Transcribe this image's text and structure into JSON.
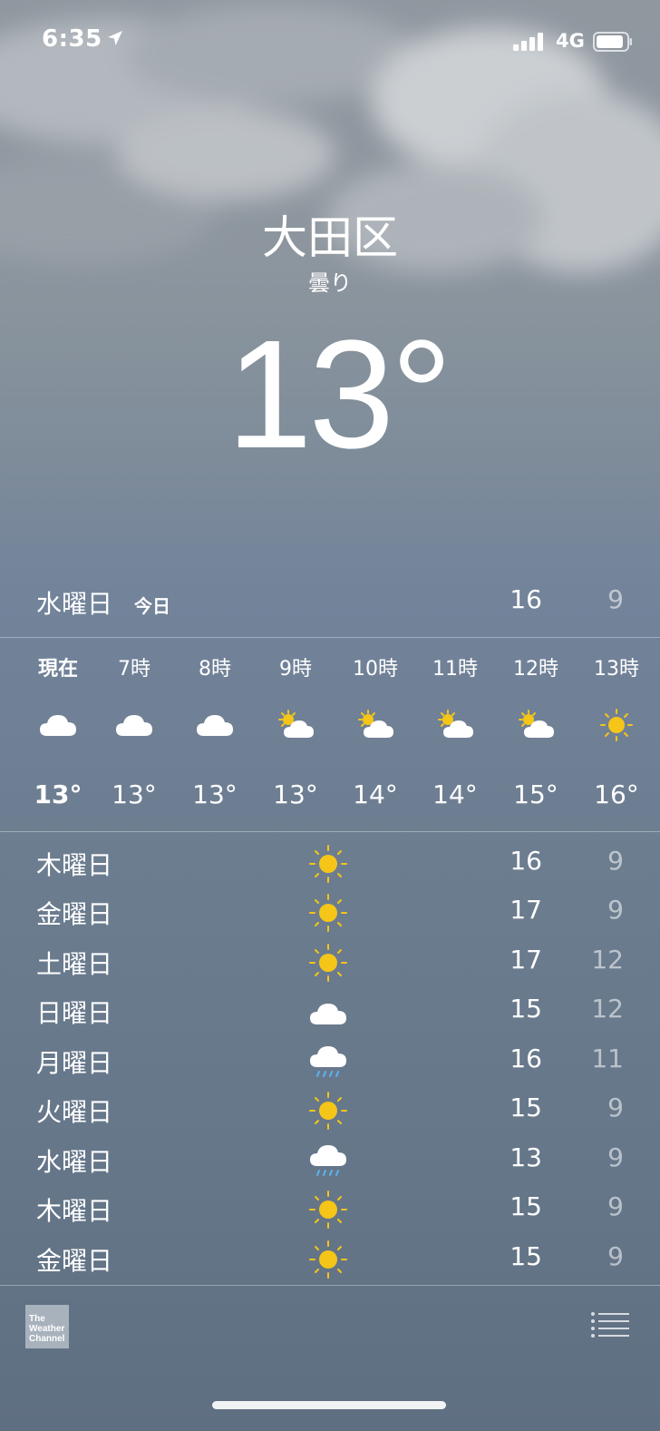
{
  "status_bar": {
    "time": "6:35",
    "network": "4G"
  },
  "location": {
    "city": "大田区",
    "condition": "曇り",
    "temperature": "13°"
  },
  "today": {
    "day": "水曜日",
    "tag": "今日",
    "high": "16",
    "low": "9"
  },
  "hourly": [
    {
      "label": "現在",
      "icon": "cloud-icon",
      "temp": "13°"
    },
    {
      "label": "7時",
      "icon": "cloud-icon",
      "temp": "13°"
    },
    {
      "label": "8時",
      "icon": "cloud-icon",
      "temp": "13°"
    },
    {
      "label": "9時",
      "icon": "partly-cloudy-icon",
      "temp": "13°"
    },
    {
      "label": "10時",
      "icon": "partly-cloudy-icon",
      "temp": "14°"
    },
    {
      "label": "11時",
      "icon": "partly-cloudy-icon",
      "temp": "14°"
    },
    {
      "label": "12時",
      "icon": "partly-cloudy-icon",
      "temp": "15°"
    },
    {
      "label": "13時",
      "icon": "sun-icon",
      "temp": "16°"
    }
  ],
  "daily": [
    {
      "day": "木曜日",
      "icon": "sun-icon",
      "high": "16",
      "low": "9"
    },
    {
      "day": "金曜日",
      "icon": "sun-icon",
      "high": "17",
      "low": "9"
    },
    {
      "day": "土曜日",
      "icon": "sun-icon",
      "high": "17",
      "low": "12"
    },
    {
      "day": "日曜日",
      "icon": "cloud-icon",
      "high": "15",
      "low": "12"
    },
    {
      "day": "月曜日",
      "icon": "rain-icon",
      "high": "16",
      "low": "11"
    },
    {
      "day": "火曜日",
      "icon": "sun-icon",
      "high": "15",
      "low": "9"
    },
    {
      "day": "水曜日",
      "icon": "rain-icon",
      "high": "13",
      "low": "9"
    },
    {
      "day": "木曜日",
      "icon": "sun-icon",
      "high": "15",
      "low": "9"
    },
    {
      "day": "金曜日",
      "icon": "sun-icon",
      "high": "15",
      "low": "9"
    }
  ],
  "footer": {
    "logo_text": [
      "The",
      "Weather",
      "Channel"
    ]
  },
  "colors": {
    "sun": "#f5c518",
    "cloud": "#ffffff",
    "rain": "#5ab4f0"
  }
}
